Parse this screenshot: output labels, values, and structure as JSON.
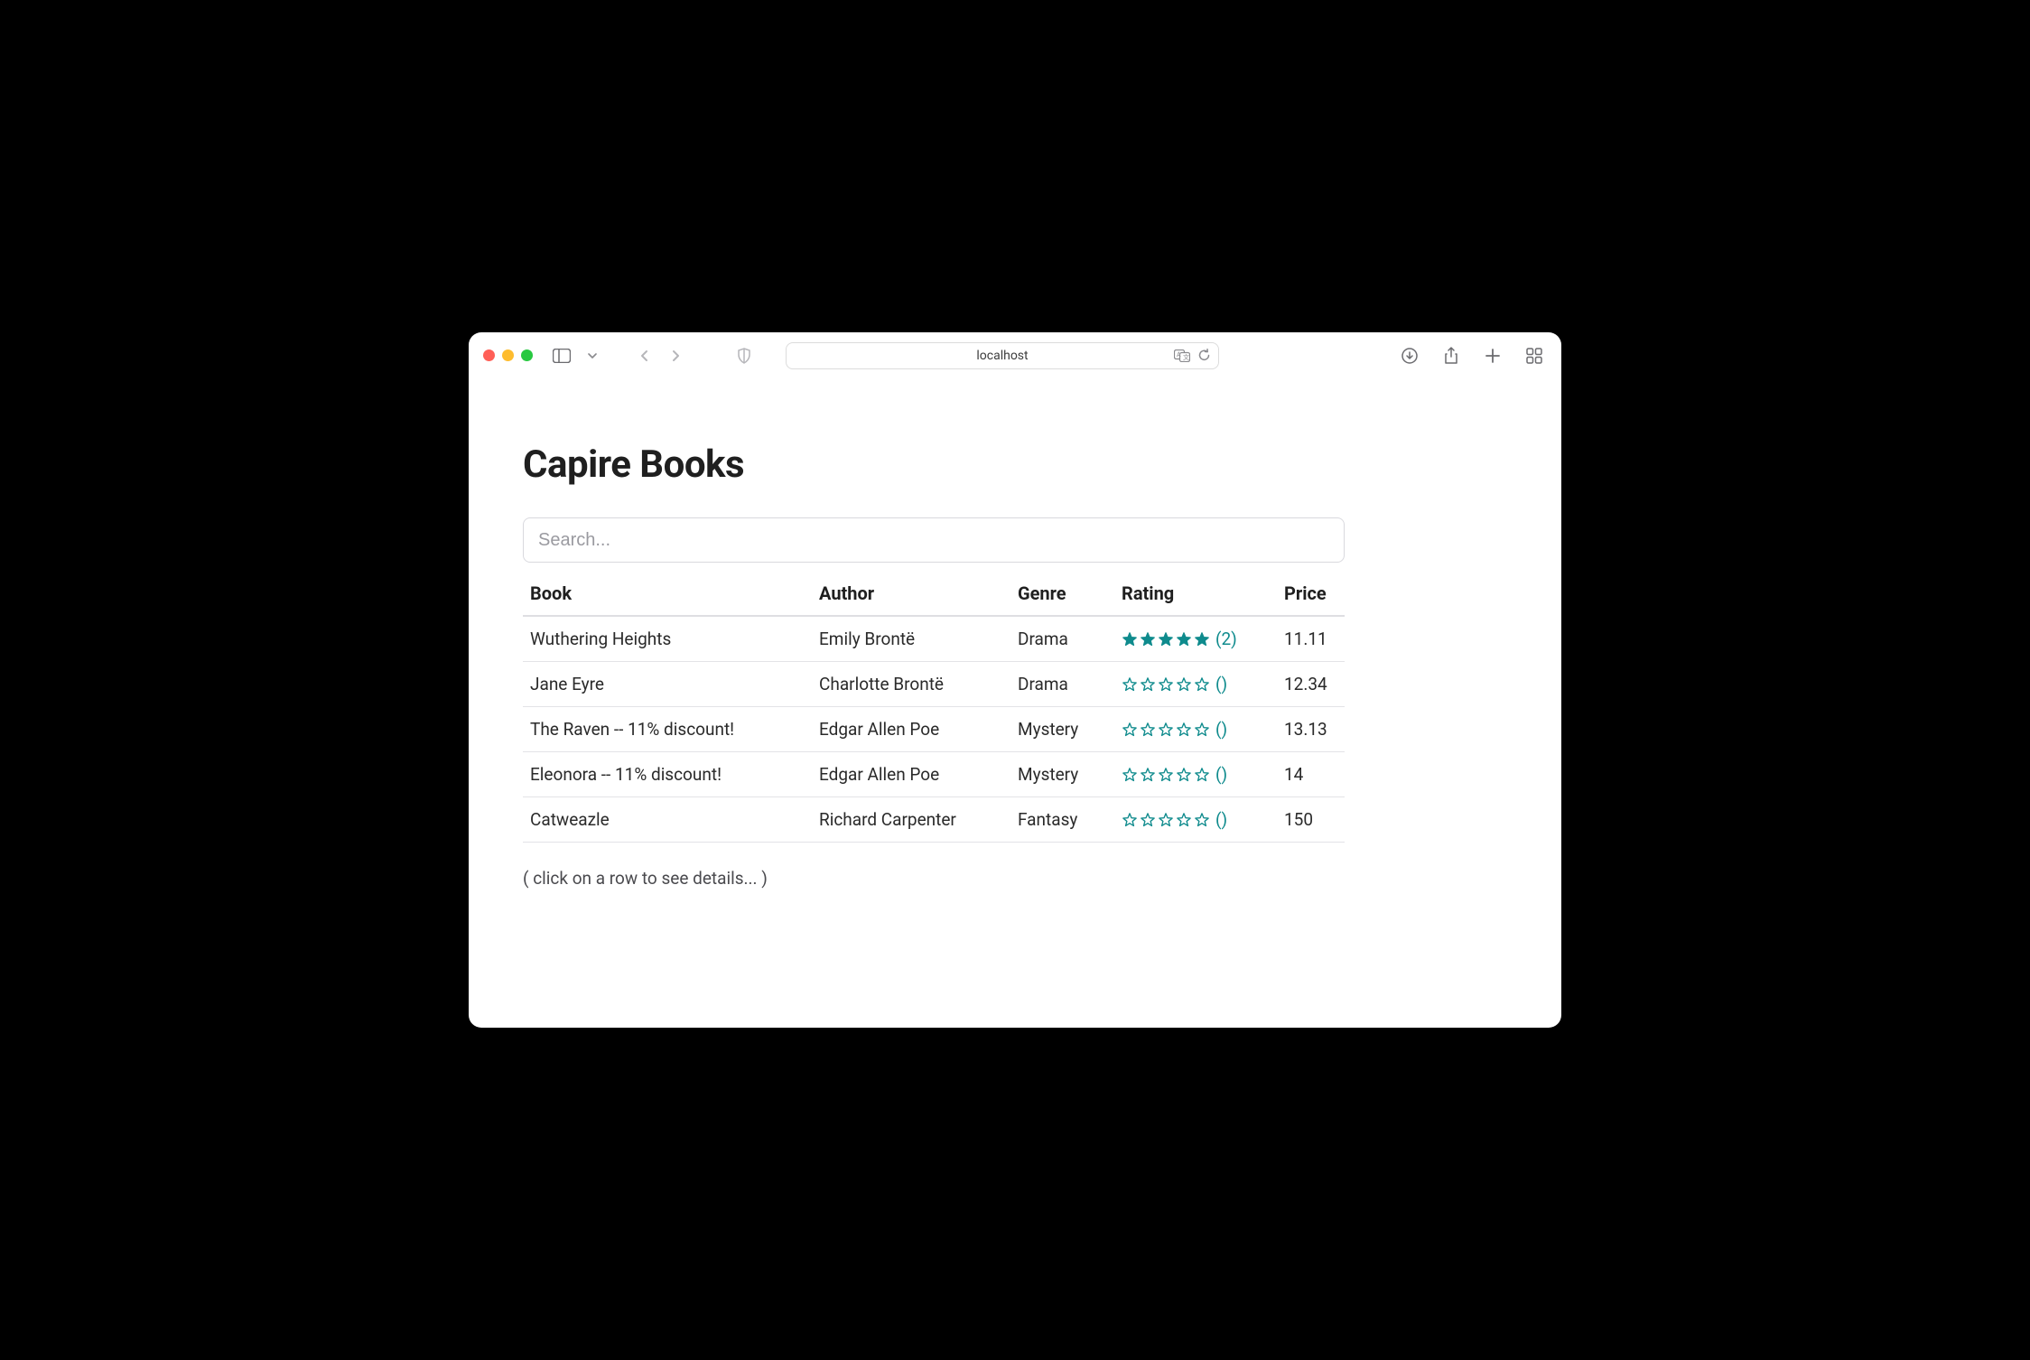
{
  "browser": {
    "url": "localhost"
  },
  "page": {
    "title": "Capire Books",
    "search_placeholder": "Search...",
    "hint": "( click on a row to see details... )"
  },
  "table": {
    "columns": {
      "book": "Book",
      "author": "Author",
      "genre": "Genre",
      "rating": "Rating",
      "price": "Price"
    },
    "rows": [
      {
        "book": "Wuthering Heights",
        "author": "Emily Brontë",
        "genre": "Drama",
        "rating_stars": 5,
        "rating_count": "2",
        "price": "11.11"
      },
      {
        "book": "Jane Eyre",
        "author": "Charlotte Brontë",
        "genre": "Drama",
        "rating_stars": 0,
        "rating_count": "",
        "price": "12.34"
      },
      {
        "book": "The Raven -- 11% discount!",
        "author": "Edgar Allen Poe",
        "genre": "Mystery",
        "rating_stars": 0,
        "rating_count": "",
        "price": "13.13"
      },
      {
        "book": "Eleonora -- 11% discount!",
        "author": "Edgar Allen Poe",
        "genre": "Mystery",
        "rating_stars": 0,
        "rating_count": "",
        "price": "14"
      },
      {
        "book": "Catweazle",
        "author": "Richard Carpenter",
        "genre": "Fantasy",
        "rating_stars": 0,
        "rating_count": "",
        "price": "150"
      }
    ]
  }
}
